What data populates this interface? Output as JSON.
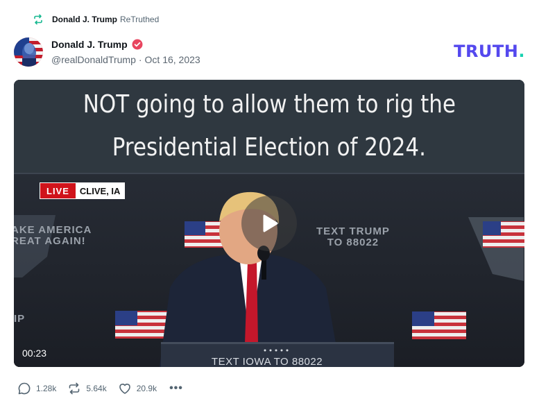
{
  "retruth": {
    "name": "Donald J. Trump",
    "label": "ReTruthed"
  },
  "post": {
    "author_name": "Donald J. Trump",
    "handle": "@realDonaldTrump",
    "date_separator": "·",
    "date": "Oct 16, 2023"
  },
  "brand": {
    "text": "TRUTH",
    "dot": "."
  },
  "video": {
    "caption_line1": "NOT going to allow them to rig the",
    "caption_line2": "Presidential Election of 2024.",
    "live_label": "LIVE",
    "location": "CLIVE, IA",
    "backdrop_left_line1": "AKE AMERICA",
    "backdrop_left_line2": "REAT AGAIN!",
    "backdrop_right_line1": "TEXT TRUMP",
    "backdrop_right_line2": "TO 88022",
    "backdrop_edge": "IP",
    "podium_text": "TEXT IOWA TO 88022",
    "duration": "00:23"
  },
  "actions": {
    "replies": "1.28k",
    "retruths": "5.64k",
    "likes": "20.9k",
    "more": "•••"
  },
  "colors": {
    "brand": "#5448ee",
    "brand_dot": "#17d1b0",
    "verified": "#e8455f",
    "retruth_icon": "#17b890",
    "live": "#d0131b"
  },
  "icons": [
    "retruth-icon",
    "verified-badge-icon",
    "play-icon",
    "reply-icon",
    "retruth-action-icon",
    "heart-icon",
    "more-icon"
  ]
}
